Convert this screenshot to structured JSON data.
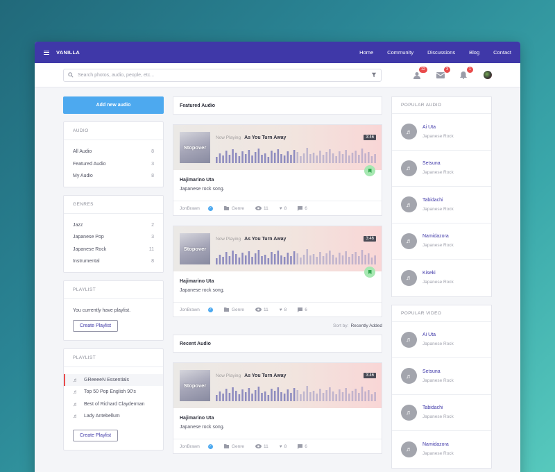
{
  "nav": {
    "brand": "VANILLA",
    "links": [
      "Home",
      "Community",
      "Discussions",
      "Blog",
      "Contact"
    ]
  },
  "search": {
    "placeholder": "Search photos, audio, people, etc..."
  },
  "badges": {
    "users": "12",
    "mail": "3",
    "bell": "1"
  },
  "left": {
    "add_button": "Add new audio",
    "audio": {
      "title": "AUDIO",
      "items": [
        {
          "label": "All Audio",
          "count": "8"
        },
        {
          "label": "Featured Audio",
          "count": "3"
        },
        {
          "label": "My Audio",
          "count": "8"
        }
      ]
    },
    "genres": {
      "title": "GENRES",
      "items": [
        {
          "label": "Jazz",
          "count": "2"
        },
        {
          "label": "Japanese Pop",
          "count": "3"
        },
        {
          "label": "Japanese Rock",
          "count": "11"
        },
        {
          "label": "Instrumental",
          "count": "8"
        }
      ]
    },
    "playlist_empty": {
      "title": "PLAYLIST",
      "text": "You currently have playlist.",
      "button": "Create Playlist"
    },
    "playlist": {
      "title": "PLAYLIST",
      "items": [
        "GReeeeN Essentials",
        "Top 50 Pop English 90's",
        "Best of Richard Clayderman",
        "Lady Antebellum"
      ],
      "button": "Create Playlist"
    }
  },
  "main": {
    "featured_title": "Featured Audio",
    "recent_title": "Recent Audio",
    "sort_label": "Sort by:",
    "sort_value": "Recently Added",
    "cards": [
      {
        "cover": "Stopover",
        "now_playing": "Now Playing",
        "track": "As You Turn Away",
        "duration": "3:46",
        "title": "Hajimarino Uta",
        "desc": "Japanese rock song.",
        "author": "JonBrawn",
        "genre": "Genre",
        "views": "11",
        "likes": "8",
        "comments": "6"
      },
      {
        "cover": "Stopover",
        "now_playing": "Now Playing",
        "track": "As You Turn Away",
        "duration": "3:46",
        "title": "Hajimarino Uta",
        "desc": "Japanese rock song.",
        "author": "JonBrawn",
        "genre": "Genre",
        "views": "11",
        "likes": "8",
        "comments": "6"
      },
      {
        "cover": "Stopover",
        "now_playing": "Now Playing",
        "track": "As You Turn Away",
        "duration": "3:46",
        "title": "Hajimarino Uta",
        "desc": "Japanese rock song.",
        "author": "JonBrawn",
        "genre": "Genre",
        "views": "11",
        "likes": "8",
        "comments": "6"
      }
    ]
  },
  "right": {
    "popular_audio": {
      "title": "POPULAR AUDIO",
      "items": [
        {
          "name": "Ai Uta",
          "genre": "Japanese Rock"
        },
        {
          "name": "Setsuna",
          "genre": "Japanese Rock"
        },
        {
          "name": "Tabidachi",
          "genre": "Japanese Rock"
        },
        {
          "name": "Namidazora",
          "genre": "Japanese Rock"
        },
        {
          "name": "Kiseki",
          "genre": "Japanese Rock"
        }
      ]
    },
    "popular_video": {
      "title": "POPULAR VIDEO",
      "items": [
        {
          "name": "Ai Uta",
          "genre": "Japanese Rock"
        },
        {
          "name": "Setsuna",
          "genre": "Japanese Rock"
        },
        {
          "name": "Tabidachi",
          "genre": "Japanese Rock"
        },
        {
          "name": "Namidazora",
          "genre": "Japanese Rock"
        }
      ]
    }
  },
  "colors": {
    "nav": "#3f38a8",
    "accent": "#4da9ef",
    "badge": "#e94b4b",
    "wave": "#8e8cbf"
  }
}
